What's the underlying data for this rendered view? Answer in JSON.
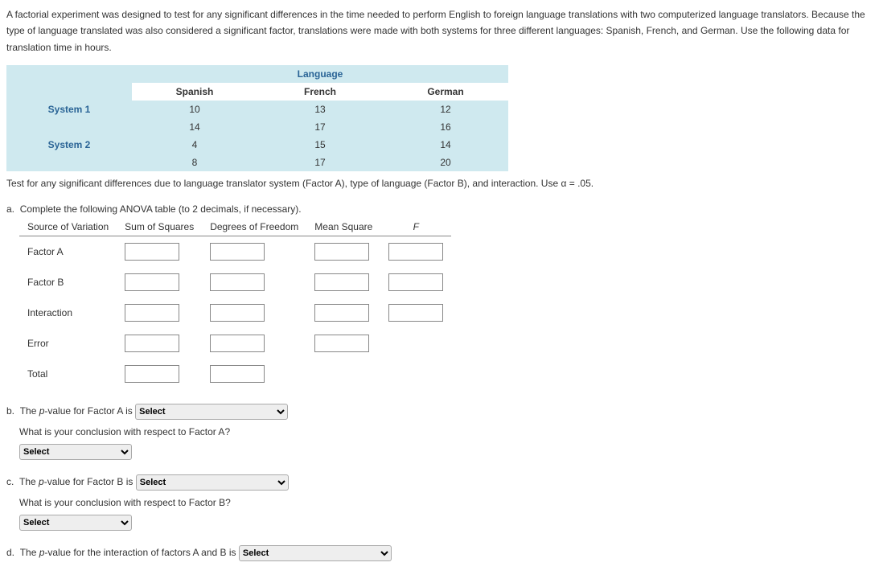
{
  "intro": "A factorial experiment was designed to test for any significant differences in the time needed to perform English to foreign language translations with two computerized language translators. Because the type of language translated was also considered a significant factor, translations were made with both systems for three different languages: Spanish, French, and German. Use the following data for translation time in hours.",
  "table": {
    "superheader": "Language",
    "cols": [
      "Spanish",
      "French",
      "German"
    ],
    "rows": [
      {
        "label": "System 1",
        "values": [
          "10",
          "13",
          "12"
        ]
      },
      {
        "label": "",
        "values": [
          "14",
          "17",
          "16"
        ]
      },
      {
        "label": "System 2",
        "values": [
          "4",
          "15",
          "14"
        ]
      },
      {
        "label": "",
        "values": [
          "8",
          "17",
          "20"
        ]
      }
    ]
  },
  "test_instr": "Test for any significant differences due to language translator system (Factor A), type of language (Factor B), and interaction. Use α = .05.",
  "parts": {
    "a": {
      "prompt": "Complete the following ANOVA table (to 2 decimals, if necessary).",
      "headers": [
        "Source of Variation",
        "Sum of Squares",
        "Degrees of Freedom",
        "Mean Square",
        "F"
      ],
      "rows": [
        "Factor A",
        "Factor B",
        "Interaction",
        "Error",
        "Total"
      ]
    },
    "b": {
      "line1_pre": "The ",
      "line1_ital": "p",
      "line1_mid": "-value for Factor A is",
      "q": "What is your conclusion with respect to Factor A?"
    },
    "c": {
      "line1_pre": "The ",
      "line1_ital": "p",
      "line1_mid": "-value for Factor B is",
      "q": "What is your conclusion with respect to Factor B?"
    },
    "d": {
      "line1_pre": "The ",
      "line1_ital": "p",
      "line1_mid": "-value for the interaction of factors A and B is"
    }
  },
  "select_placeholder": "Select"
}
